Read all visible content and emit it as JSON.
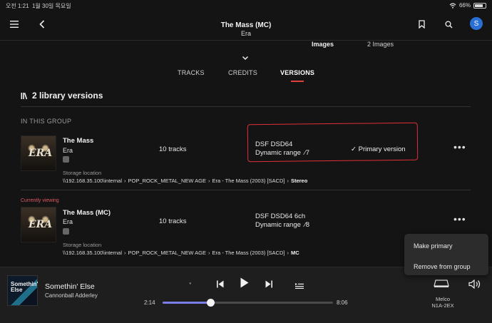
{
  "status": {
    "time": "오전 1:21",
    "date": "1월 30일 목요일",
    "battery": "66%"
  },
  "header": {
    "title": "The Mass (MC)",
    "subtitle": "Era",
    "avatar": "S"
  },
  "images": {
    "label": "Images",
    "value": "2 Images"
  },
  "tabs": [
    {
      "label": "TRACKS",
      "active": false
    },
    {
      "label": "CREDITS",
      "active": false
    },
    {
      "label": "VERSIONS",
      "active": true
    }
  ],
  "section_title": "2 library versions",
  "group_label": "IN THIS GROUP",
  "currently_viewing": "Currently viewing",
  "versions": [
    {
      "album": "The Mass",
      "artist": "Era",
      "tracks": "10 tracks",
      "format": "DSF DSD64",
      "dynamic_range": "Dynamic range",
      "dr_value": "7",
      "primary": "Primary version",
      "storage_label": "Storage location",
      "path": [
        "\\\\192.168.35.100\\internal",
        "POP_ROCK_METAL_NEW AGE",
        "Era - The Mass (2003) [SACD]",
        "Stereo"
      ]
    },
    {
      "album": "The Mass (MC)",
      "artist": "Era",
      "tracks": "10 tracks",
      "format": "DSF DSD64 6ch",
      "dynamic_range": "Dynamic range",
      "dr_value": "8",
      "primary": "",
      "storage_label": "Storage location",
      "path": [
        "\\\\192.168.35.100\\internal",
        "POP_ROCK_METAL_NEW AGE",
        "Era - The Mass (2003) [SACD]",
        "MC"
      ]
    }
  ],
  "context_menu": {
    "make_primary": "Make primary",
    "remove_from_group": "Remove from group"
  },
  "player": {
    "title": "Somethin' Else",
    "artist": "Cannonball Adderley",
    "elapsed": "2:14",
    "duration": "8:06",
    "progress": 0.28,
    "zone_name": "Melco",
    "zone_device": "N1A-2EX",
    "cover_text": "Somethin' Else"
  },
  "colors": {
    "accent": "#e04040",
    "avatar": "#2a6fd6",
    "progress": "#7a7fe8",
    "highlight": "#e03038"
  }
}
